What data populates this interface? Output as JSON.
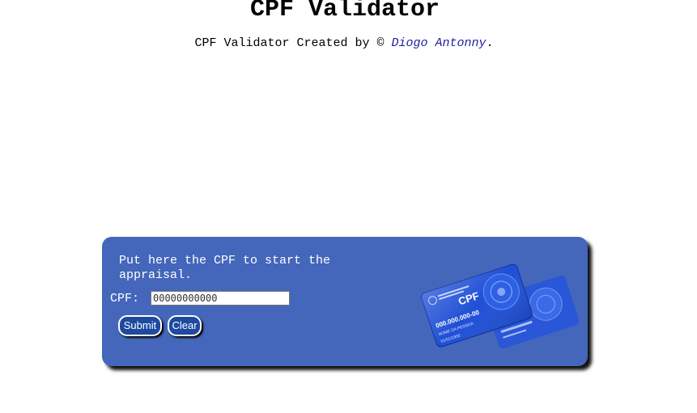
{
  "header": {
    "title": "CPF Validator",
    "credit_prefix": "CPF Validator Created by © ",
    "author_link": "Diogo Antonny",
    "credit_suffix": "."
  },
  "form": {
    "instruction": "Put here the CPF to start the appraisal.",
    "cpf_label": "CPF:",
    "cpf_value": "00000000000",
    "submit_label": "Submit",
    "clear_label": "Clear"
  },
  "card_image": {
    "card_title": "CPF",
    "card_number": "000.000.000-00",
    "card_name": "NOME DA PESSOA",
    "card_date": "01/01/1900",
    "icon": "cpf-card-illustration"
  },
  "colors": {
    "panel_bg": "#4466bb",
    "button_bg": "#1e4aa0",
    "link": "#2020a0"
  }
}
